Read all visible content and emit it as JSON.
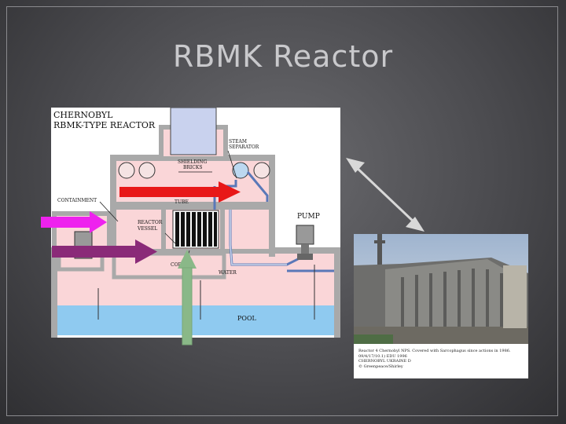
{
  "slide": {
    "title": "RBMK Reactor"
  },
  "diagram": {
    "heading_line1": "CHERNOBYL",
    "heading_line2": "RBMK-TYPE REACTOR",
    "labels": {
      "steam_separator_1": "STEAM",
      "steam_separator_2": "SEPARATOR",
      "shielding_1": "SHIELDING",
      "shielding_2": "BRICKS",
      "containment": "CONTAINMENT",
      "tube": "TUBE",
      "pump": "PUMP",
      "reactor_vessel_1": "REACTOR",
      "reactor_vessel_2": "VESSEL",
      "core": "COR",
      "water": "WATER",
      "pool": "POOL"
    },
    "colors": {
      "wall": "#a9a9a9",
      "fill": "#fad6d8",
      "pool": "#8fcaf0",
      "pipe": "#5a78b8",
      "arrow_red": "#e81818",
      "arrow_magenta": "#ee22ee",
      "arrow_purple": "#8a2a78",
      "arrow_green": "#8ab888"
    }
  },
  "photo": {
    "caption_lines": [
      "Reactor 4 Chernobyl NPS. Covered with Sarcophagus since actions in 1986.",
      "09/4/17/10.1)    EDU 1996",
      "CHERNOBYL UKRAINE   D",
      "© Greenpeace/Shirley"
    ]
  }
}
